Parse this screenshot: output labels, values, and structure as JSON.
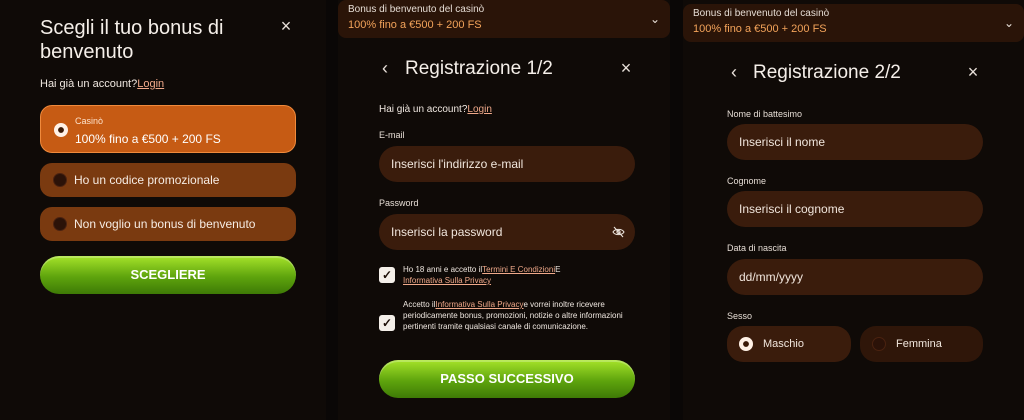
{
  "panel1": {
    "title": "Scegli il tuo bonus di benvenuto",
    "close_icon": "×",
    "account_prefix": "Hai già un account?",
    "login_link": "Login",
    "options": [
      {
        "label": "Casinò",
        "value": "100% fino a €500 + 200 FS",
        "selected": true
      },
      {
        "label": "Ho un codice promozionale",
        "selected": false
      },
      {
        "label": "Non voglio un bonus di benvenuto",
        "selected": false
      }
    ],
    "button": "SCEGLIERE"
  },
  "panel2": {
    "bonus_dropdown": {
      "label": "Bonus di benvenuto del casinò",
      "value": "100% fino a €500 + 200 FS"
    },
    "title": "Registrazione 1/2",
    "back_icon": "‹",
    "close_icon": "×",
    "account_prefix": "Hai già un account?",
    "login_link": "Login",
    "email_label": "E-mail",
    "email_placeholder": "Inserisci l'indirizzo e-mail",
    "password_label": "Password",
    "password_placeholder": "Inserisci la password",
    "consent1": {
      "text_a": "Ho 18 anni e accetto il",
      "link1": "Termini E Condizioni",
      "text_b": "E",
      "link2": "Informativa Sulla Privacy"
    },
    "consent2": {
      "text_a": "Accetto il",
      "link": "Informativa Sulla Privacy",
      "text_b": "e vorrei inoltre ricevere periodicamente bonus, promozioni, notizie o altre informazioni pertinenti tramite qualsiasi canale di comunicazione."
    },
    "button": "PASSO SUCCESSIVO"
  },
  "panel3": {
    "bonus_dropdown": {
      "label": "Bonus di benvenuto del casinò",
      "value": "100% fino a €500 + 200 FS"
    },
    "title": "Registrazione 2/2",
    "back_icon": "‹",
    "close_icon": "×",
    "first_name_label": "Nome di battesimo",
    "first_name_placeholder": "Inserisci il nome",
    "last_name_label": "Cognome",
    "last_name_placeholder": "Inserisci il cognome",
    "dob_label": "Data di nascita",
    "dob_placeholder": "dd/mm/yyyy",
    "sex_label": "Sesso",
    "male": "Maschio",
    "female": "Femmina",
    "male_selected": true
  },
  "colors": {
    "accent_orange": "#c65b14",
    "option_brown": "#7a3a10",
    "input_brown": "#3a1c0c",
    "green": "#7cc21a",
    "link": "#f0a98a"
  }
}
